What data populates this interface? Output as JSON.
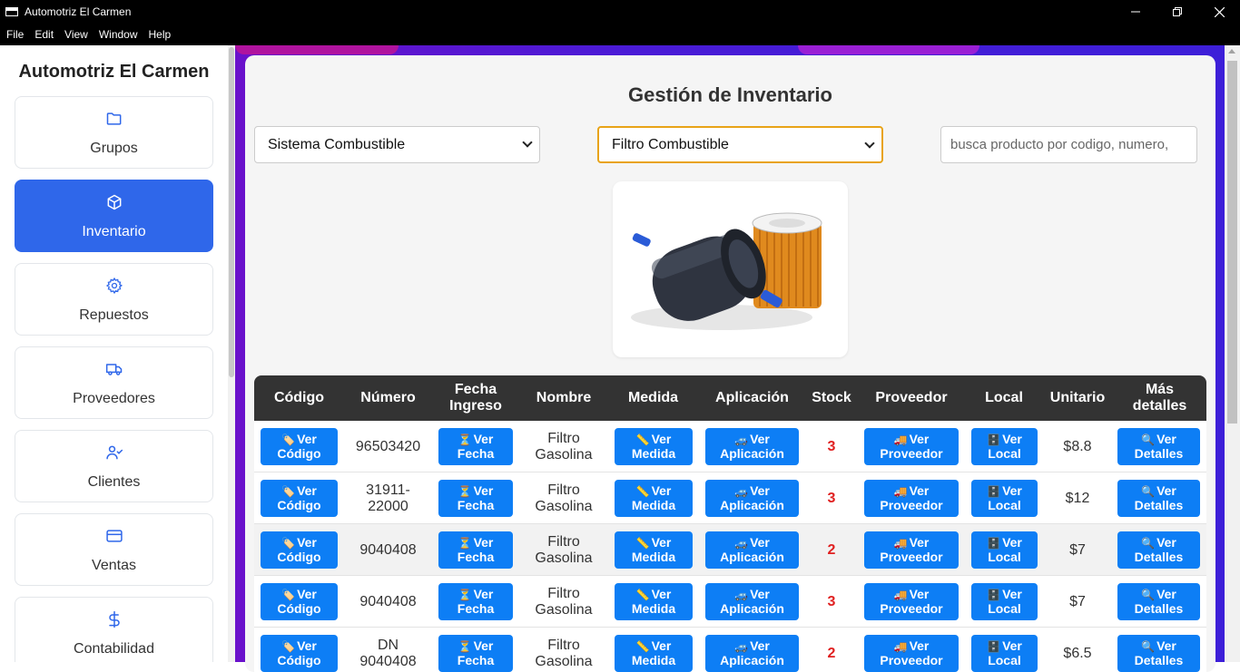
{
  "window": {
    "title": "Automotriz El Carmen",
    "controls": [
      "minimize-icon",
      "restore-icon",
      "close-icon"
    ]
  },
  "menu": [
    "File",
    "Edit",
    "View",
    "Window",
    "Help"
  ],
  "sidebar": {
    "brand": "Automotriz El Carmen",
    "active_color": "#2f67ea",
    "items": [
      {
        "label": "Grupos",
        "icon": "folder-icon",
        "active": false
      },
      {
        "label": "Inventario",
        "icon": "box-icon",
        "active": true
      },
      {
        "label": "Repuestos",
        "icon": "gear-icon",
        "active": false
      },
      {
        "label": "Proveedores",
        "icon": "truck-icon",
        "active": false
      },
      {
        "label": "Clientes",
        "icon": "user-check-icon",
        "active": false
      },
      {
        "label": "Ventas",
        "icon": "credit-card-icon",
        "active": false
      },
      {
        "label": "Contabilidad",
        "icon": "dollar-icon",
        "active": false
      }
    ]
  },
  "main": {
    "heading": "Gestión de Inventario",
    "category_select": "Sistema Combustible",
    "subcategory_select": "Filtro Combustible",
    "search_placeholder": "busca producto por codigo, numero,",
    "product_image": "fuel-filter-image"
  },
  "table": {
    "headers": [
      "Código",
      "Número",
      "Fecha Ingreso",
      "Nombre",
      "Medida",
      "Aplicación",
      "Stock",
      "Proveedor",
      "Local",
      "Unitario",
      "Más detalles"
    ],
    "buttons": {
      "codigo": {
        "emoji": "🏷️",
        "label": "Ver Código"
      },
      "fecha": {
        "emoji": "⏳",
        "label": "Ver Fecha"
      },
      "medida": {
        "emoji": "📏",
        "label": "Ver Medida"
      },
      "aplicacion": {
        "emoji": "🚙",
        "label": "Ver Aplicación"
      },
      "proveedor": {
        "emoji": "🚚",
        "label": "Ver Proveedor"
      },
      "local": {
        "emoji": "🗄️",
        "label": "Ver Local"
      },
      "detalles": {
        "emoji": "🔍",
        "label": "Ver Detalles"
      }
    },
    "rows": [
      {
        "numero": "96503420",
        "nombre": "Filtro Gasolina",
        "stock": "3",
        "unitario": "$8.8"
      },
      {
        "numero": "31911-22000",
        "nombre": "Filtro Gasolina",
        "stock": "3",
        "unitario": "$12"
      },
      {
        "numero": "9040408",
        "nombre": "Filtro Gasolina",
        "stock": "2",
        "unitario": "$7"
      },
      {
        "numero": "9040408",
        "nombre": "Filtro Gasolina",
        "stock": "3",
        "unitario": "$7"
      },
      {
        "numero": "DN 9040408",
        "nombre": "Filtro Gasolina",
        "stock": "2",
        "unitario": "$6.5"
      }
    ]
  },
  "colors": {
    "button_blue": "#0d7ef5",
    "stock_red": "#e02020",
    "header_dark": "#333333",
    "background_purple": "#4a1bd6",
    "focus_orange": "#e8a317"
  }
}
